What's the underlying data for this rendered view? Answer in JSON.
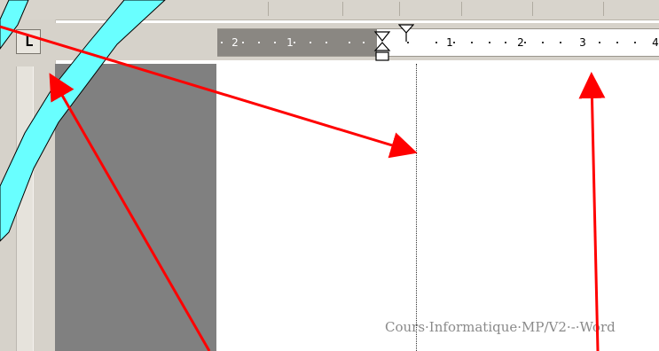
{
  "window": {
    "title": ""
  },
  "ruler": {
    "tab_selector_glyph": "L",
    "numbers": [
      "2",
      "1",
      "1",
      "2",
      "3",
      "4"
    ]
  },
  "document": {
    "footer_text": "Cours·Informatique·MP/V2·-·Word"
  },
  "colors": {
    "annotation_arrow": "#ff0000",
    "ribbon": "#69ffff",
    "ruler_margin": "#8a8782",
    "gray_column": "#808080"
  },
  "icons": {
    "tab_selector": "left-tab-icon",
    "first_line_indent": "first-line-indent-icon",
    "hanging_indent": "hanging-indent-icon",
    "left_indent": "left-indent-icon"
  }
}
